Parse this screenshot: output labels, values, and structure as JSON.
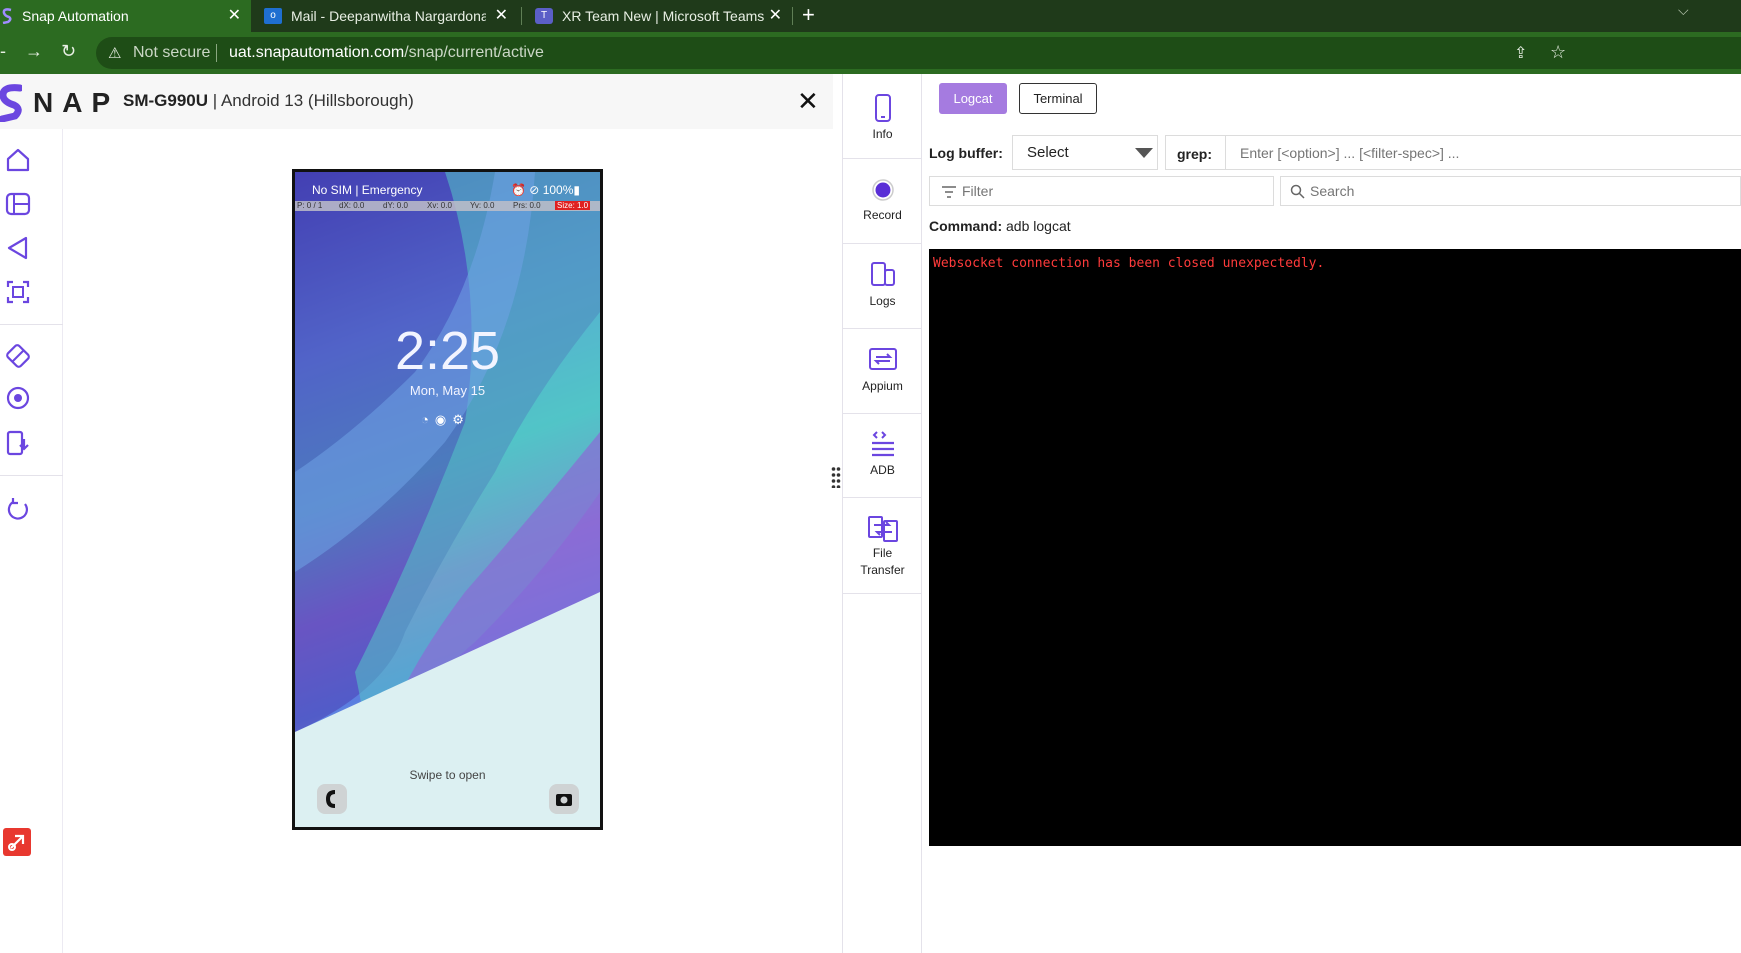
{
  "browser": {
    "tabs": [
      {
        "title": "Snap Automation",
        "icon": "snap-logo-icon",
        "active": true
      },
      {
        "title": "Mail - Deepanwitha Nargardona",
        "icon": "outlook-icon",
        "active": false
      },
      {
        "title": "XR Team New | Microsoft Teams",
        "icon": "teams-icon",
        "active": false
      }
    ],
    "close_glyph": "✕",
    "new_tab_glyph": "+",
    "security_label": "Not secure",
    "url_host": "uat.snapautomation.com",
    "url_path": "/snap/current/active"
  },
  "app": {
    "logo_text": "NAP",
    "device_model": "SM-G990U",
    "device_info": " | Android 13 (Hillsborough)",
    "close_glyph": "✕",
    "brand_color": "#6b46e0"
  },
  "phone": {
    "status_left": "No SIM | Emergency",
    "status_right": "⏰ ⊘ 100%▮",
    "pointer": {
      "p": "P: 0 / 1",
      "dx": "dX: 0.0",
      "dy": "dY: 0.0",
      "xv": "Xv: 0.0",
      "yv": "Yv: 0.0",
      "prs": "Prs: 0.0",
      "size": "Size: 1.0"
    },
    "time": "2:25",
    "date": "Mon, May 15",
    "lock_icons": "◔◉⚙",
    "swipe_text": "Swipe to open"
  },
  "sidemenu": [
    {
      "label": "Info",
      "icon": "phone-icon"
    },
    {
      "label": "Record",
      "icon": "record-icon"
    },
    {
      "label": "Logs",
      "icon": "devices-icon"
    },
    {
      "label": "Appium",
      "icon": "appium-icon"
    },
    {
      "label": "ADB",
      "icon": "adb-icon"
    },
    {
      "label": "File",
      "label2": "Transfer",
      "icon": "file-transfer-icon"
    }
  ],
  "logs": {
    "tab_logcat": "Logcat",
    "tab_terminal": "Terminal",
    "log_buffer_label": "Log buffer:",
    "log_buffer_value": "Select",
    "grep_label": "grep:",
    "grep_placeholder": "Enter [<option>] ... [<filter-spec>] ...",
    "filter_placeholder": "Filter",
    "search_placeholder": "Search",
    "command_label": "Command:",
    "command_value": " adb logcat",
    "console_error": "Websocket connection has been closed unexpectedly.",
    "error_color": "#ff3b3b"
  }
}
